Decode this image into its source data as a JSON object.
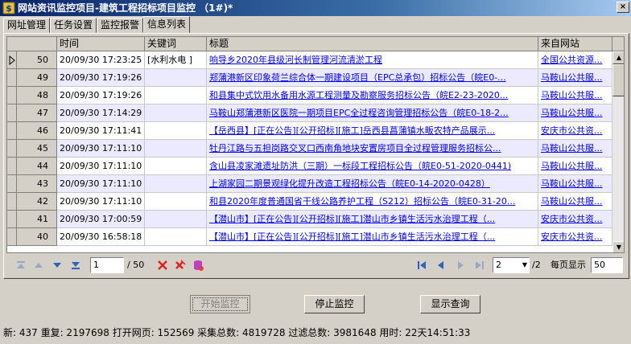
{
  "window": {
    "title": "网站资讯监控项目-建筑工程招标项目监控  （1#)*",
    "close_label": "×"
  },
  "tabs": [
    {
      "label": "网址管理",
      "active": false
    },
    {
      "label": "任务设置",
      "active": false
    },
    {
      "label": "监控报警",
      "active": false
    },
    {
      "label": "信息列表",
      "active": true
    }
  ],
  "table": {
    "columns": [
      "时间",
      "关键词",
      "标题",
      "来自网站"
    ],
    "rows": [
      {
        "id": "50",
        "time": "20/09/30 17:23:25",
        "keyword": "[水利水电 ]",
        "title": "响导乡2020年县级河长制管理河流清淤工程",
        "site": "全国公共资源..."
      },
      {
        "id": "49",
        "time": "20/09/30 17:19:26",
        "keyword": "",
        "title": "郑蒲港新区印象荷兰综合体一期建设项目（EPC总承包）招标公告（皖E0-...",
        "site": "马鞍山公共服..."
      },
      {
        "id": "48",
        "time": "20/09/30 17:19:26",
        "keyword": "",
        "title": "和县集中式饮用水备用水源工程测量及勘察服务招标公告（皖E2-23-2020...",
        "site": "马鞍山公共服..."
      },
      {
        "id": "47",
        "time": "20/09/30 17:14:29",
        "keyword": "",
        "title": "马鞍山郑蒲港新区医院一期项目EPC全过程咨询管理招标公告（皖E0-18-2...",
        "site": "马鞍山公共服..."
      },
      {
        "id": "46",
        "time": "20/09/30 17:11:41",
        "keyword": "",
        "title": "【岳西县】[正在公告][公开招标][施工]岳西县菖蒲镇水畈农特产品展示...",
        "site": "安庆市公共资..."
      },
      {
        "id": "45",
        "time": "20/09/30 17:11:10",
        "keyword": "",
        "title": "牡丹江路与五担岗路交叉口西南角地块安置房项目全过程管理服务招标公...",
        "site": "马鞍山公共服..."
      },
      {
        "id": "44",
        "time": "20/09/30 17:11:10",
        "keyword": "",
        "title": "含山县凌家滩遗址防洪（三期）一标段工程招标公告（皖E0-51-2020-0441)",
        "site": "马鞍山公共服..."
      },
      {
        "id": "43",
        "time": "20/09/30 17:11:10",
        "keyword": "",
        "title": "上湖家园二期景观绿化提升改造工程招标公告（皖E0-14-2020-0428）",
        "site": "马鞍山公共服..."
      },
      {
        "id": "42",
        "time": "20/09/30 17:11:10",
        "keyword": "",
        "title": "和县2020年度普通国省干线公路养护工程（S212）招标公告（皖E0-31-20...",
        "site": "马鞍山公共服..."
      },
      {
        "id": "41",
        "time": "20/09/30 17:00:59",
        "keyword": "",
        "title": "【潜山市】[正在公告][公开招标][施工]潜山市乡镇生活污水治理工程（...",
        "site": "安庆市公共资..."
      },
      {
        "id": "40",
        "time": "20/09/30 16:58:18",
        "keyword": "",
        "title": "【潜山市】[正在公告][公开招标][施工]潜山市乡镇生活污水治理工程（...",
        "site": "安庆市公共资..."
      }
    ]
  },
  "pager": {
    "current_page": "1",
    "total_pages": "/ 50",
    "nav_page": "2",
    "nav_total": "/2",
    "page_size_label": "每页显示",
    "page_size": "50"
  },
  "buttons": {
    "start": "开始监控",
    "stop": "停止监控",
    "query": "显示查询"
  },
  "status": {
    "text": "新: 437 重复: 2197698 打开网页: 152569 采集总数: 4819728 过滤总数: 3981648 用时: 22天14:51:33"
  },
  "colors": {
    "link": "#0000ee",
    "alt_row": "#ebeaff",
    "title_bar": "#0a246a"
  }
}
